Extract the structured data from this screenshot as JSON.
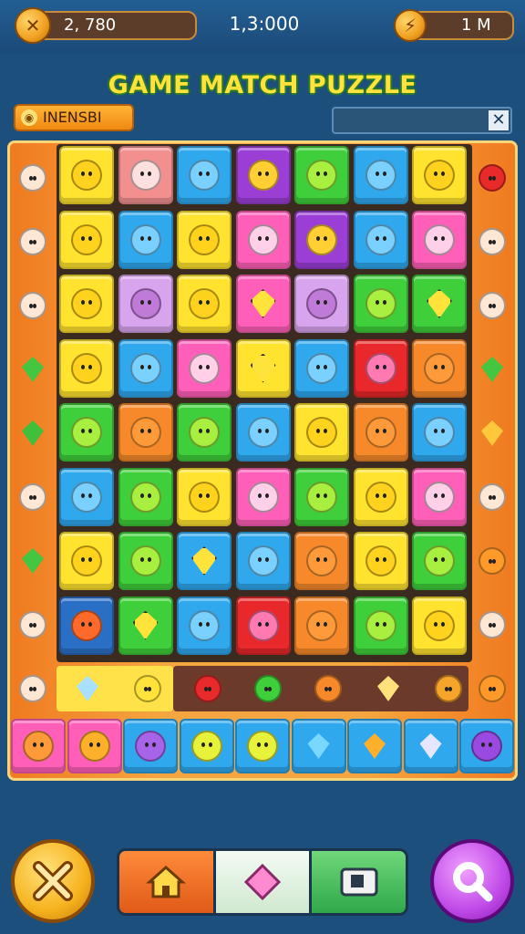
{
  "header": {
    "coins_value": "2, 780",
    "center_score": "1,3:000",
    "right_value": "1 M",
    "left_icon": "coin-icon",
    "right_icon": "lightning-coin-icon"
  },
  "title": "GAME MATCH PUZZLE",
  "tag_label": "INENSBI",
  "search": {
    "close_icon": "close-icon"
  },
  "colors": {
    "yellow": "#ffe32e",
    "pink": "#ff5fb8",
    "blue": "#2fa8ee",
    "green": "#3fcf3a",
    "purple": "#9b3ed6",
    "red": "#e8282a",
    "orange": "#f7892a",
    "salmon": "#f29090",
    "lavender": "#d9a4ee",
    "navy": "#2a6fc6"
  },
  "board": {
    "rows": [
      [
        "yellow",
        "salmon",
        "blue",
        "purple",
        "green",
        "blue",
        "yellow"
      ],
      [
        "yellow",
        "blue",
        "yellow",
        "pink",
        "purple",
        "blue",
        "pink"
      ],
      [
        "yellow",
        "lavender",
        "yellow",
        "pink",
        "lavender",
        "green",
        "green"
      ],
      [
        "yellow",
        "blue",
        "pink",
        "yellow",
        "blue",
        "red",
        "orange"
      ],
      [
        "green",
        "orange",
        "green",
        "blue",
        "yellow",
        "orange",
        "blue"
      ],
      [
        "blue",
        "green",
        "yellow",
        "pink",
        "green",
        "yellow",
        "pink"
      ],
      [
        "yellow",
        "green",
        "blue",
        "blue",
        "orange",
        "yellow",
        "green"
      ],
      [
        "navy",
        "green",
        "blue",
        "red",
        "orange",
        "green",
        "yellow"
      ]
    ],
    "icons": [
      [
        "blob",
        "cat",
        "mushroom",
        "lion",
        "blob",
        "drop",
        "fruit"
      ],
      [
        "crab",
        "blob",
        "cat",
        "cat",
        "blob",
        "drop",
        "blob"
      ],
      [
        "leaf",
        "mushroom",
        "leaf",
        "star",
        "flower",
        "blob",
        "star"
      ],
      [
        "fish",
        "blob",
        "cat",
        "star",
        "cat",
        "mushroom",
        "leaf"
      ],
      [
        "blob",
        "fruit",
        "blob",
        "blob",
        "crab",
        "blob",
        "blob"
      ],
      [
        "drop",
        "blob",
        "blob",
        "cat",
        "blob",
        "blob",
        "blob"
      ],
      [
        "blob",
        "mushroom",
        "star",
        "blob",
        "blob",
        "blob",
        "blob"
      ],
      [
        "blob",
        "star",
        "blob",
        "fruit",
        "fruit",
        "blob",
        "blob"
      ]
    ]
  },
  "left_column": [
    "face",
    "face",
    "face",
    "leaf",
    "star",
    "face",
    "grass",
    "face",
    "face"
  ],
  "right_column": [
    "apple",
    "face",
    "face",
    "leaf",
    "gem",
    "face",
    "fruit",
    "face",
    "fruit"
  ],
  "shelf_items": [
    "gem",
    "face",
    "apple",
    "apple",
    "orange",
    "basket",
    "fruit"
  ],
  "bottom_row": [
    "pink",
    "pink",
    "blue",
    "blue",
    "blue",
    "blue",
    "blue",
    "blue",
    "blue"
  ],
  "bottom_row_icons": [
    "face",
    "face",
    "face",
    "face",
    "face",
    "gem",
    "gem",
    "gem",
    "fruit"
  ],
  "controls": {
    "left_button_icon": "close-icon",
    "nav": [
      "home-icon",
      "gem-icon",
      "camera-icon"
    ],
    "right_button_icon": "search-icon"
  }
}
